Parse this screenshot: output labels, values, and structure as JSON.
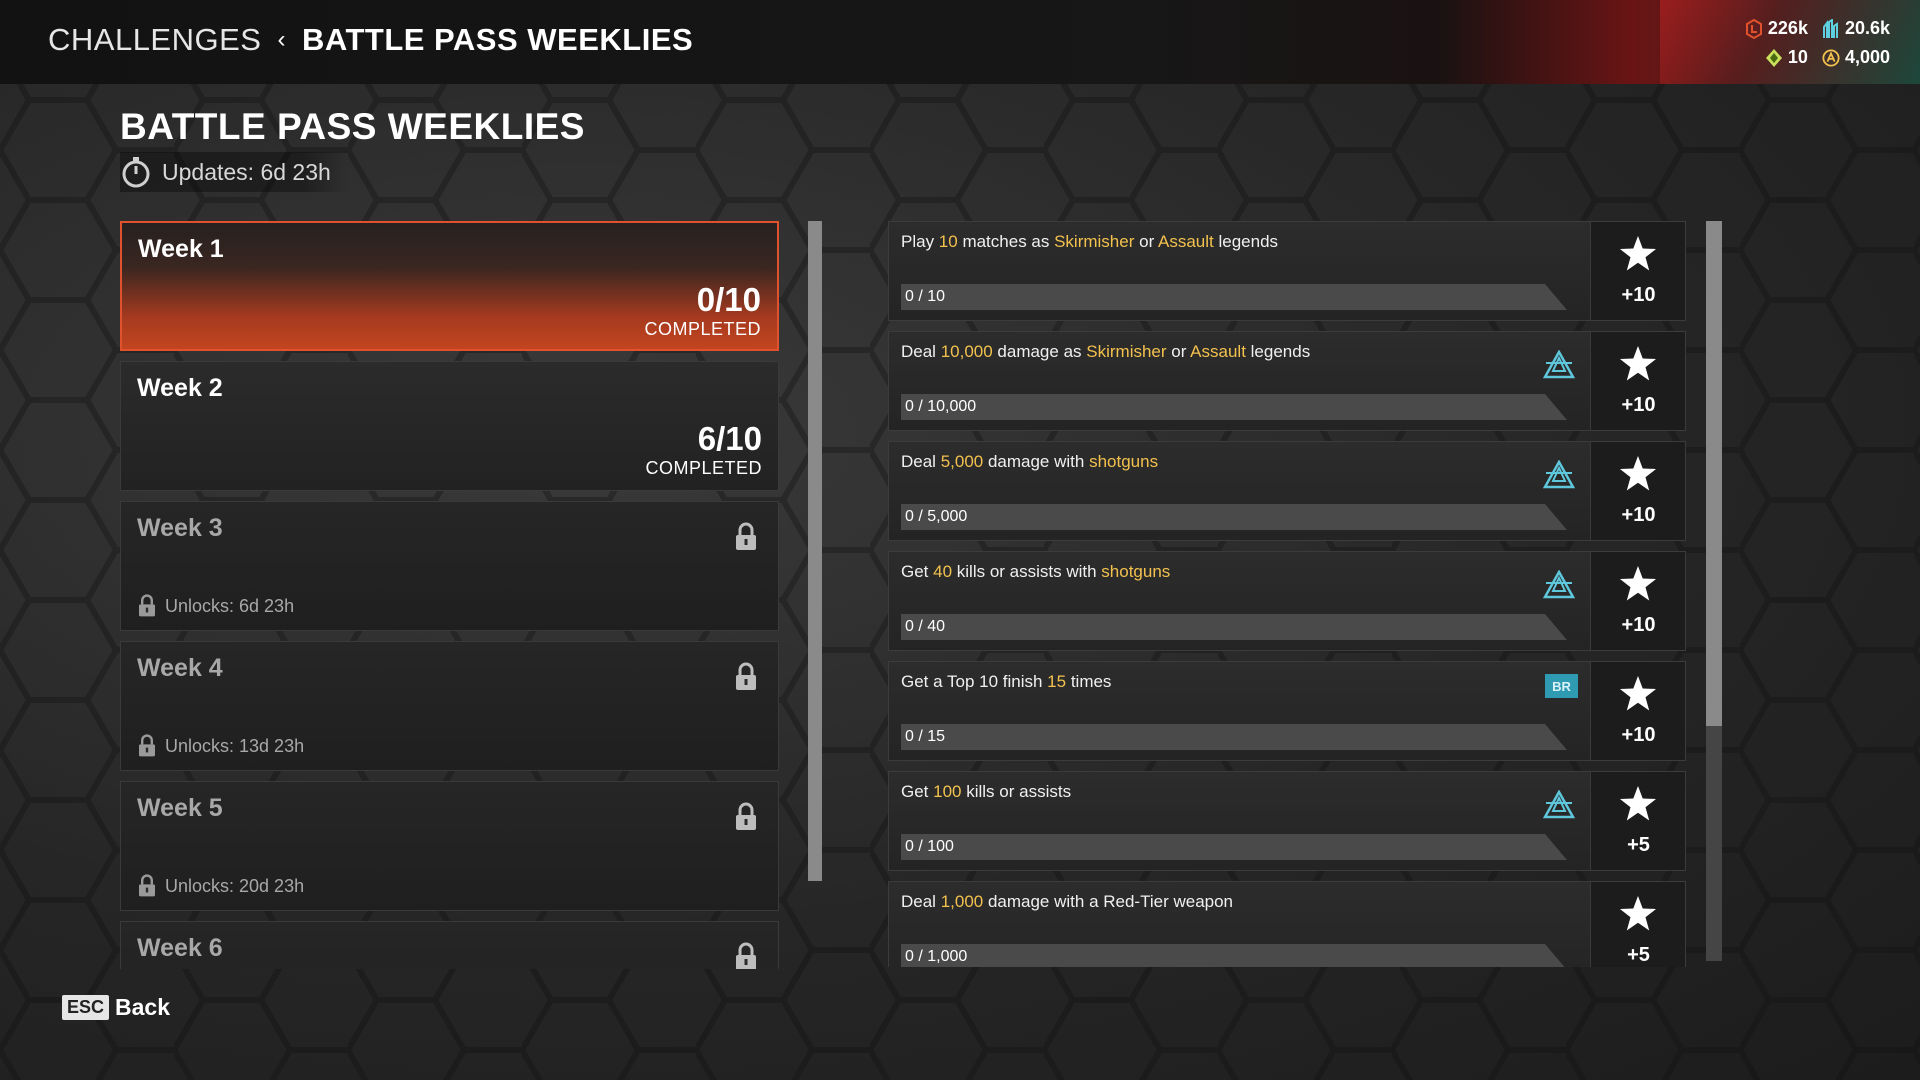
{
  "breadcrumb": {
    "root": "CHALLENGES",
    "separator": "‹",
    "current": "BATTLE PASS WEEKLIES"
  },
  "currencies": {
    "row1": [
      {
        "icon": "legend-tokens-icon",
        "value": "226k",
        "color": "#e0512d"
      },
      {
        "icon": "crafting-metals-icon",
        "value": "20.6k",
        "color": "#5fd0e0"
      }
    ],
    "row2": [
      {
        "icon": "exotic-shards-icon",
        "value": "10",
        "color": "#c8e05a"
      },
      {
        "icon": "apex-coins-icon",
        "value": "4,000",
        "color": "#f2c14e"
      }
    ]
  },
  "page": {
    "title": "BATTLE PASS WEEKLIES",
    "updates": "Updates: 6d 23h"
  },
  "weeks": [
    {
      "name": "Week 1",
      "progress": "0/10",
      "completed_label": "COMPLETED",
      "state": "active"
    },
    {
      "name": "Week 2",
      "progress": "6/10",
      "completed_label": "COMPLETED",
      "state": "available"
    },
    {
      "name": "Week 3",
      "unlocks": "Unlocks: 6d 23h",
      "state": "locked"
    },
    {
      "name": "Week 4",
      "unlocks": "Unlocks: 13d 23h",
      "state": "locked"
    },
    {
      "name": "Week 5",
      "unlocks": "Unlocks: 20d 23h",
      "state": "locked"
    },
    {
      "name": "Week 6",
      "state": "locked"
    }
  ],
  "challenges": [
    {
      "desc": [
        {
          "t": "Play "
        },
        {
          "t": "10",
          "h": true
        },
        {
          "t": " matches as "
        },
        {
          "t": "Skirmisher",
          "h": true
        },
        {
          "t": " or "
        },
        {
          "t": "Assault",
          "h": true
        },
        {
          "t": " legends"
        }
      ],
      "progress": "0 / 10",
      "tag": "",
      "reward": "+10"
    },
    {
      "desc": [
        {
          "t": "Deal "
        },
        {
          "t": "10,000",
          "h": true
        },
        {
          "t": " damage as "
        },
        {
          "t": "Skirmisher",
          "h": true
        },
        {
          "t": " or "
        },
        {
          "t": "Assault",
          "h": true
        },
        {
          "t": " legends"
        }
      ],
      "progress": "0 / 10,000",
      "tag": "any-mode-icon",
      "reward": "+10"
    },
    {
      "desc": [
        {
          "t": "Deal "
        },
        {
          "t": "5,000",
          "h": true
        },
        {
          "t": " damage with "
        },
        {
          "t": "shotguns",
          "h": true
        }
      ],
      "progress": "0 / 5,000",
      "tag": "any-mode-icon",
      "reward": "+10"
    },
    {
      "desc": [
        {
          "t": "Get "
        },
        {
          "t": "40",
          "h": true
        },
        {
          "t": " kills or assists with "
        },
        {
          "t": "shotguns",
          "h": true
        }
      ],
      "progress": "0 / 40",
      "tag": "any-mode-icon",
      "reward": "+10"
    },
    {
      "desc": [
        {
          "t": "Get a Top 10 finish "
        },
        {
          "t": "15",
          "h": true
        },
        {
          "t": " times"
        }
      ],
      "progress": "0 / 15",
      "tag": "BR",
      "reward": "+10"
    },
    {
      "desc": [
        {
          "t": "Get "
        },
        {
          "t": "100",
          "h": true
        },
        {
          "t": " kills or assists"
        }
      ],
      "progress": "0 / 100",
      "tag": "any-mode-icon",
      "reward": "+5"
    },
    {
      "desc": [
        {
          "t": "Deal "
        },
        {
          "t": "1,000",
          "h": true
        },
        {
          "t": " damage with a Red-Tier weapon"
        }
      ],
      "progress": "0 / 1,000",
      "tag": "",
      "reward": "+5"
    }
  ],
  "footer": {
    "key": "ESC",
    "label": "Back"
  }
}
